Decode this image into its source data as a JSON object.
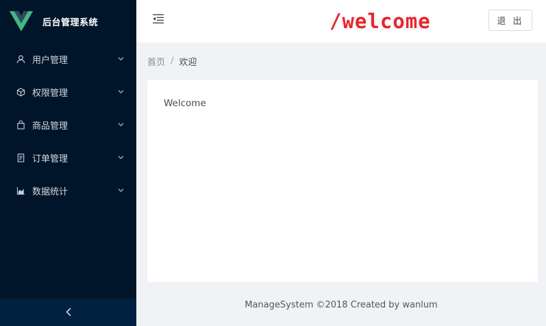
{
  "app": {
    "title": "后台管理系统"
  },
  "sidebar": {
    "items": [
      {
        "label": "用户管理",
        "icon": "user-icon"
      },
      {
        "label": "权限管理",
        "icon": "cube-icon"
      },
      {
        "label": "商品管理",
        "icon": "shopping-bag-icon"
      },
      {
        "label": "订单管理",
        "icon": "receipt-icon"
      },
      {
        "label": "数据统计",
        "icon": "area-chart-icon"
      }
    ],
    "collapse_icon": "chevron-left-icon"
  },
  "header": {
    "route": "/welcome",
    "logout_label": "退 出",
    "fold_icon": "menu-fold-icon"
  },
  "breadcrumb": {
    "home": "首页",
    "separator": "/",
    "current": "欢迎"
  },
  "content": {
    "text": "Welcome"
  },
  "footer": {
    "text": "ManageSystem ©2018 Created by wanlum"
  },
  "colors": {
    "sidebar_bg": "#001529",
    "collapse_bg": "#002140",
    "route_title": "#e8242d",
    "page_bg": "#f0f2f5",
    "logo_green": "#41b883",
    "logo_dark": "#35495e"
  }
}
